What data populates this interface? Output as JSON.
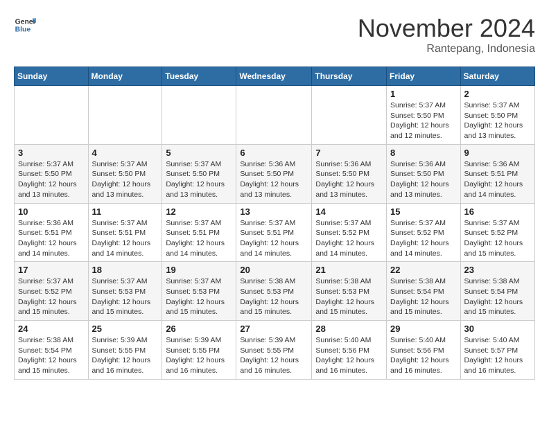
{
  "header": {
    "logo_line1": "General",
    "logo_line2": "Blue",
    "month": "November 2024",
    "location": "Rantepang, Indonesia"
  },
  "days_of_week": [
    "Sunday",
    "Monday",
    "Tuesday",
    "Wednesday",
    "Thursday",
    "Friday",
    "Saturday"
  ],
  "weeks": [
    [
      {
        "day": "",
        "info": ""
      },
      {
        "day": "",
        "info": ""
      },
      {
        "day": "",
        "info": ""
      },
      {
        "day": "",
        "info": ""
      },
      {
        "day": "",
        "info": ""
      },
      {
        "day": "1",
        "info": "Sunrise: 5:37 AM\nSunset: 5:50 PM\nDaylight: 12 hours and 12 minutes."
      },
      {
        "day": "2",
        "info": "Sunrise: 5:37 AM\nSunset: 5:50 PM\nDaylight: 12 hours and 13 minutes."
      }
    ],
    [
      {
        "day": "3",
        "info": "Sunrise: 5:37 AM\nSunset: 5:50 PM\nDaylight: 12 hours and 13 minutes."
      },
      {
        "day": "4",
        "info": "Sunrise: 5:37 AM\nSunset: 5:50 PM\nDaylight: 12 hours and 13 minutes."
      },
      {
        "day": "5",
        "info": "Sunrise: 5:37 AM\nSunset: 5:50 PM\nDaylight: 12 hours and 13 minutes."
      },
      {
        "day": "6",
        "info": "Sunrise: 5:36 AM\nSunset: 5:50 PM\nDaylight: 12 hours and 13 minutes."
      },
      {
        "day": "7",
        "info": "Sunrise: 5:36 AM\nSunset: 5:50 PM\nDaylight: 12 hours and 13 minutes."
      },
      {
        "day": "8",
        "info": "Sunrise: 5:36 AM\nSunset: 5:50 PM\nDaylight: 12 hours and 13 minutes."
      },
      {
        "day": "9",
        "info": "Sunrise: 5:36 AM\nSunset: 5:51 PM\nDaylight: 12 hours and 14 minutes."
      }
    ],
    [
      {
        "day": "10",
        "info": "Sunrise: 5:36 AM\nSunset: 5:51 PM\nDaylight: 12 hours and 14 minutes."
      },
      {
        "day": "11",
        "info": "Sunrise: 5:37 AM\nSunset: 5:51 PM\nDaylight: 12 hours and 14 minutes."
      },
      {
        "day": "12",
        "info": "Sunrise: 5:37 AM\nSunset: 5:51 PM\nDaylight: 12 hours and 14 minutes."
      },
      {
        "day": "13",
        "info": "Sunrise: 5:37 AM\nSunset: 5:51 PM\nDaylight: 12 hours and 14 minutes."
      },
      {
        "day": "14",
        "info": "Sunrise: 5:37 AM\nSunset: 5:52 PM\nDaylight: 12 hours and 14 minutes."
      },
      {
        "day": "15",
        "info": "Sunrise: 5:37 AM\nSunset: 5:52 PM\nDaylight: 12 hours and 14 minutes."
      },
      {
        "day": "16",
        "info": "Sunrise: 5:37 AM\nSunset: 5:52 PM\nDaylight: 12 hours and 15 minutes."
      }
    ],
    [
      {
        "day": "17",
        "info": "Sunrise: 5:37 AM\nSunset: 5:52 PM\nDaylight: 12 hours and 15 minutes."
      },
      {
        "day": "18",
        "info": "Sunrise: 5:37 AM\nSunset: 5:53 PM\nDaylight: 12 hours and 15 minutes."
      },
      {
        "day": "19",
        "info": "Sunrise: 5:37 AM\nSunset: 5:53 PM\nDaylight: 12 hours and 15 minutes."
      },
      {
        "day": "20",
        "info": "Sunrise: 5:38 AM\nSunset: 5:53 PM\nDaylight: 12 hours and 15 minutes."
      },
      {
        "day": "21",
        "info": "Sunrise: 5:38 AM\nSunset: 5:53 PM\nDaylight: 12 hours and 15 minutes."
      },
      {
        "day": "22",
        "info": "Sunrise: 5:38 AM\nSunset: 5:54 PM\nDaylight: 12 hours and 15 minutes."
      },
      {
        "day": "23",
        "info": "Sunrise: 5:38 AM\nSunset: 5:54 PM\nDaylight: 12 hours and 15 minutes."
      }
    ],
    [
      {
        "day": "24",
        "info": "Sunrise: 5:38 AM\nSunset: 5:54 PM\nDaylight: 12 hours and 15 minutes."
      },
      {
        "day": "25",
        "info": "Sunrise: 5:39 AM\nSunset: 5:55 PM\nDaylight: 12 hours and 16 minutes."
      },
      {
        "day": "26",
        "info": "Sunrise: 5:39 AM\nSunset: 5:55 PM\nDaylight: 12 hours and 16 minutes."
      },
      {
        "day": "27",
        "info": "Sunrise: 5:39 AM\nSunset: 5:55 PM\nDaylight: 12 hours and 16 minutes."
      },
      {
        "day": "28",
        "info": "Sunrise: 5:40 AM\nSunset: 5:56 PM\nDaylight: 12 hours and 16 minutes."
      },
      {
        "day": "29",
        "info": "Sunrise: 5:40 AM\nSunset: 5:56 PM\nDaylight: 12 hours and 16 minutes."
      },
      {
        "day": "30",
        "info": "Sunrise: 5:40 AM\nSunset: 5:57 PM\nDaylight: 12 hours and 16 minutes."
      }
    ]
  ]
}
